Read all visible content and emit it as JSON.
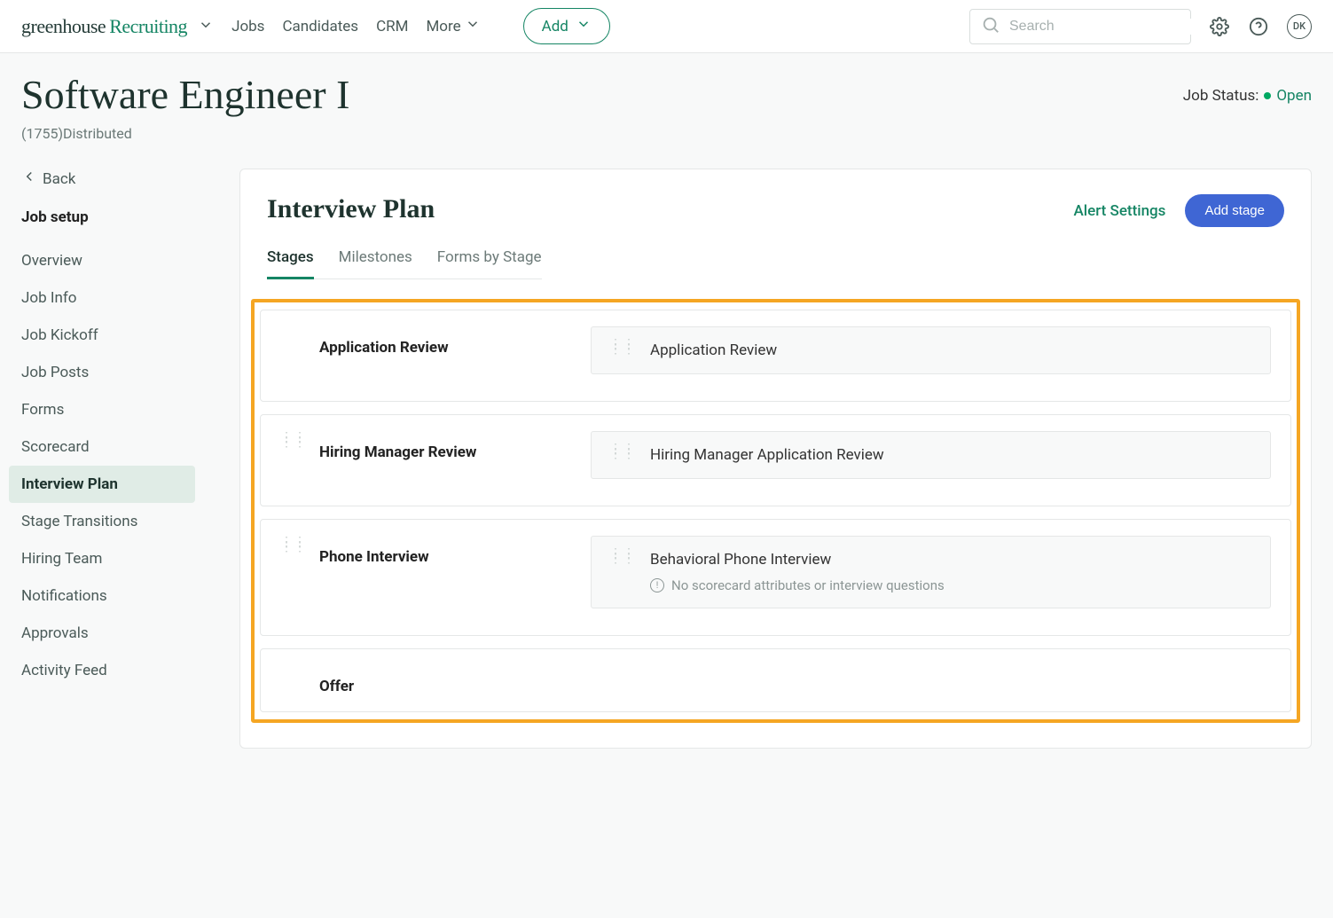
{
  "header": {
    "logo_part1": "greenhouse",
    "logo_part2": "Recruiting",
    "nav": {
      "jobs": "Jobs",
      "candidates": "Candidates",
      "crm": "CRM",
      "more": "More"
    },
    "add_button": "Add",
    "search_placeholder": "Search",
    "avatar_initials": "DK"
  },
  "job": {
    "title": "Software Engineer I",
    "req_id": "(1755)",
    "office": "Distributed",
    "status_label": "Job Status:",
    "status_value": "Open"
  },
  "sidebar": {
    "back": "Back",
    "heading": "Job setup",
    "items": {
      "overview": "Overview",
      "job_info": "Job Info",
      "job_kickoff": "Job Kickoff",
      "job_posts": "Job Posts",
      "forms": "Forms",
      "scorecard": "Scorecard",
      "interview_plan": "Interview Plan",
      "stage_transitions": "Stage Transitions",
      "hiring_team": "Hiring Team",
      "notifications": "Notifications",
      "approvals": "Approvals",
      "activity_feed": "Activity Feed"
    }
  },
  "panel": {
    "title": "Interview Plan",
    "alert_settings": "Alert Settings",
    "add_stage": "Add stage",
    "tabs": {
      "stages": "Stages",
      "milestones": "Milestones",
      "forms_by_stage": "Forms by Stage"
    }
  },
  "stages": {
    "app_review": {
      "name": "Application Review",
      "interview": "Application Review"
    },
    "hmr": {
      "name": "Hiring Manager Review",
      "interview": "Hiring Manager Application Review"
    },
    "phone": {
      "name": "Phone Interview",
      "interview": "Behavioral Phone Interview",
      "warning": "No scorecard attributes or interview questions"
    },
    "offer": {
      "name": "Offer"
    }
  }
}
